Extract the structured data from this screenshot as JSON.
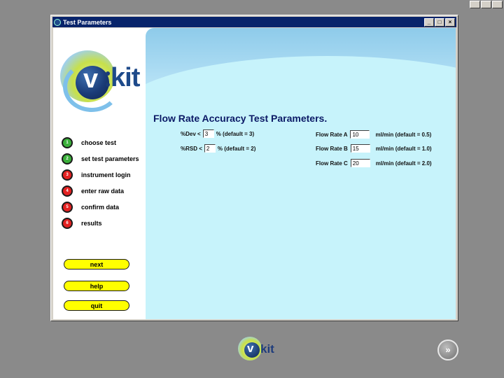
{
  "window": {
    "title": "Test Parameters",
    "controls": [
      "_",
      "□",
      "×"
    ]
  },
  "logo": {
    "v": "v",
    "kit": "kit"
  },
  "steps": [
    {
      "num": "1",
      "label": "choose test",
      "status": "done"
    },
    {
      "num": "2",
      "label": "set test parameters",
      "status": "current"
    },
    {
      "num": "3",
      "label": "instrument login",
      "status": "todo"
    },
    {
      "num": "4",
      "label": "enter raw data",
      "status": "todo"
    },
    {
      "num": "5",
      "label": "confirm data",
      "status": "todo"
    },
    {
      "num": "6",
      "label": "results",
      "status": "todo"
    }
  ],
  "nav": {
    "next": "next",
    "help": "help",
    "quit": "quit"
  },
  "form": {
    "heading": "Flow Rate Accuracy Test Parameters.",
    "dev": {
      "label": "%Dev <",
      "value": "3",
      "note": "% (default = 3)"
    },
    "rsd": {
      "label": "%RSD <",
      "value": "2",
      "note": "% (default = 2)"
    },
    "flow_a": {
      "label": "Flow Rate A",
      "value": "10",
      "note": "ml/min (default = 0.5)"
    },
    "flow_b": {
      "label": "Flow Rate B",
      "value": "15",
      "note": "ml/min (default = 1.0)"
    },
    "flow_c": {
      "label": "Flow Rate C",
      "value": "20",
      "note": "ml/min (default = 2.0)"
    }
  },
  "footer": {
    "v": "v",
    "kit": "kit",
    "forward": "»"
  },
  "colors": {
    "titlebar": "#08246b",
    "panel": "#c7f3fb",
    "button": "#ffff00",
    "done": "#3bb03b",
    "todo": "#e32222"
  }
}
